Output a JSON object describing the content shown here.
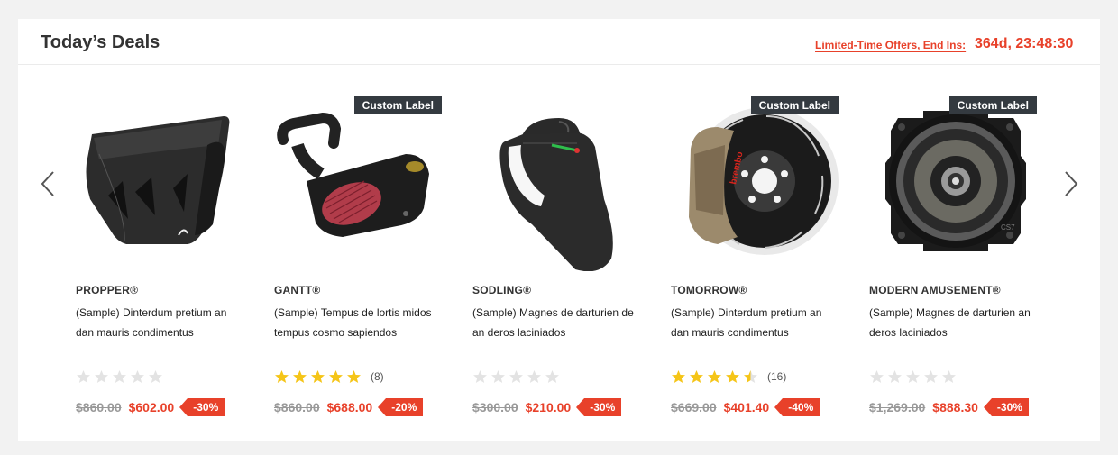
{
  "header": {
    "title": "Today’s Deals",
    "countdown_label": "Limited-Time Offers, End Ins:",
    "countdown_time": "364d, 23:48:30"
  },
  "carousel": {
    "prev_icon": "chevron-left-icon",
    "next_icon": "chevron-right-icon"
  },
  "colors": {
    "accent": "#e8412a",
    "label_bg": "#343a40",
    "star_filled": "#f5c518",
    "star_empty": "#e3e3e3"
  },
  "products": [
    {
      "image": "carbon-fiber-hood",
      "label": "",
      "brand": "PROPPER®",
      "name": "(Sample) Dinterdum pretium an dan mauris condimentus",
      "rating": 0,
      "reviews": "",
      "old_price": "$860.00",
      "price": "$602.00",
      "discount": "-30%"
    },
    {
      "image": "cold-air-intake",
      "label": "Custom Label",
      "brand": "GANTT®",
      "name": "(Sample) Tempus de lortis midos tempus cosmo sapiendos",
      "rating": 5,
      "reviews": "(8)",
      "old_price": "$860.00",
      "price": "$688.00",
      "discount": "-20%"
    },
    {
      "image": "phone-holder",
      "label": "",
      "brand": "SODLING®",
      "name": "(Sample) Magnes de darturien de an deros laciniados",
      "rating": 0,
      "reviews": "",
      "old_price": "$300.00",
      "price": "$210.00",
      "discount": "-30%"
    },
    {
      "image": "brake-disc-caliper",
      "label": "Custom Label",
      "brand": "TOMORROW®",
      "name": "(Sample) Dinterdum pretium an dan mauris condimentus",
      "rating": 4.5,
      "reviews": "(16)",
      "old_price": "$669.00",
      "price": "$401.40",
      "discount": "-40%"
    },
    {
      "image": "car-speaker",
      "label": "Custom Label",
      "brand": "MODERN AMUSEMENT®",
      "name": "(Sample) Magnes de darturien an deros laciniados",
      "rating": 0,
      "reviews": "",
      "old_price": "$1,269.00",
      "price": "$888.30",
      "discount": "-30%"
    }
  ]
}
